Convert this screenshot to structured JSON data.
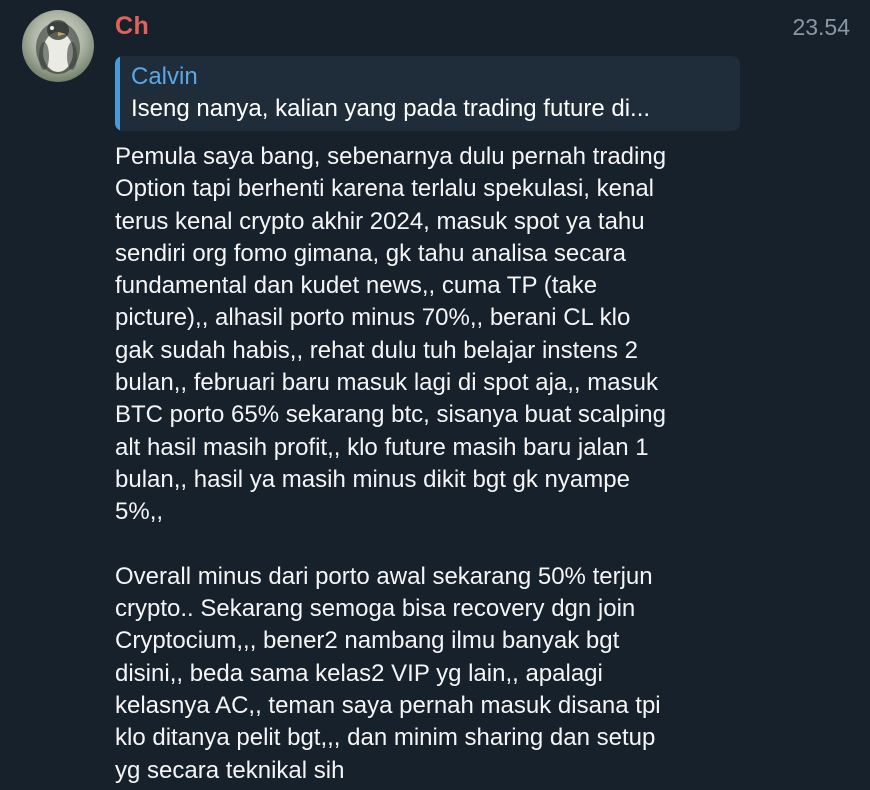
{
  "message": {
    "sender": "Ch",
    "time": "23.54",
    "reply": {
      "author": "Calvin",
      "text": "Iseng nanya, kalian yang pada trading future di..."
    },
    "paragraphs": [
      "Pemula saya bang, sebenarnya dulu pernah trading\nOption tapi berhenti karena terlalu spekulasi, kenal\nterus kenal crypto akhir 2024, masuk spot ya tahu\nsendiri org fomo gimana, gk tahu analisa secara\nfundamental dan kudet news,, cuma TP (take\npicture),, alhasil porto minus 70%,, berani CL klo\ngak sudah habis,, rehat dulu tuh belajar instens 2\nbulan,, februari baru masuk lagi di spot aja,, masuk\nBTC porto 65% sekarang btc, sisanya buat scalping\nalt hasil masih profit,, klo future masih baru jalan 1\nbulan,, hasil ya masih minus dikit bgt gk nyampe\n5%,,",
      "Overall minus dari porto awal sekarang 50% terjun\ncrypto.. Sekarang semoga bisa recovery dgn join\nCryptocium,,, bener2 nambang ilmu banyak bgt\ndisini,, beda sama kelas2 VIP yg lain,, apalagi\nkelasnya AC,, teman saya pernah masuk disana tpi\nklo ditanya pelit bgt,,, dan minim sharing dan setup\nyg secara teknikal sih"
    ]
  },
  "colors": {
    "background": "#17212b",
    "sender_name": "#e0625a",
    "reply_accent": "#4a9ad8",
    "timestamp": "#8a98a5"
  },
  "icons": {
    "avatar": "penguin-avatar"
  }
}
